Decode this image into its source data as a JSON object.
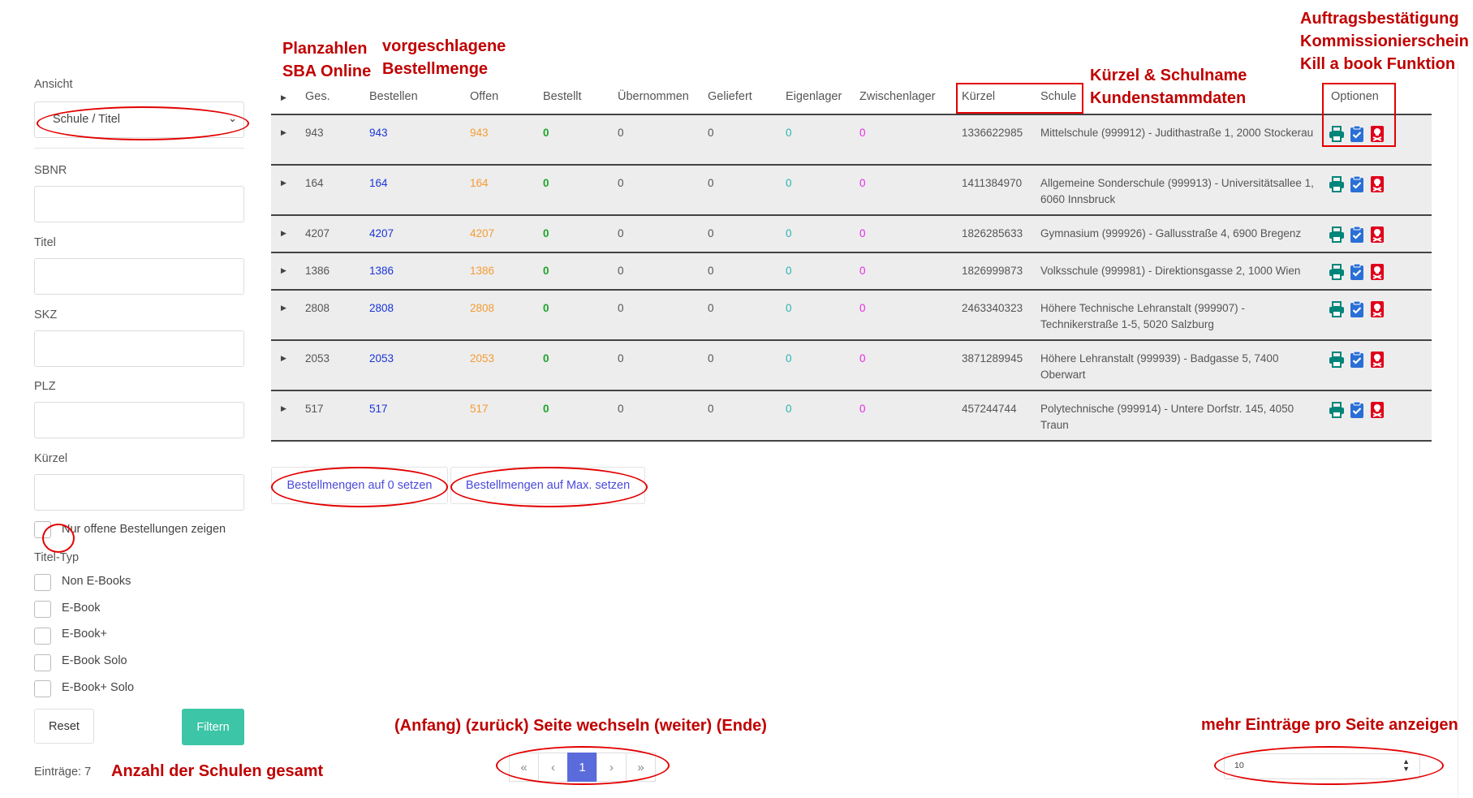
{
  "sidebar": {
    "view_label": "Ansicht",
    "view_value": "Schule / Titel",
    "sbnr_label": "SBNR",
    "title_label": "Titel",
    "skz_label": "SKZ",
    "plz_label": "PLZ",
    "kuerzel_label": "Kürzel",
    "open_only_label": "Nur offene Bestellungen zeigen",
    "title_type_label": "Titel-Typ",
    "title_types": [
      "Non E-Books",
      "E-Book",
      "E-Book+",
      "E-Book Solo",
      "E-Book+ Solo"
    ],
    "reset_label": "Reset",
    "filter_label": "Filtern",
    "entries_text": "Einträge: 7",
    "filter_color": "#3cc5a6"
  },
  "table": {
    "headers": {
      "ges": "Ges.",
      "bestellen": "Bestellen",
      "offen": "Offen",
      "bestellt": "Bestellt",
      "uebernommen": "Übernommen",
      "geliefert": "Geliefert",
      "eigenlager": "Eigenlager",
      "zwischenlager": "Zwischenlager",
      "kuerzel": "Kürzel",
      "schule": "Schule",
      "optionen": "Optionen"
    },
    "rows": [
      {
        "ges": "943",
        "bestellen": "943",
        "offen": "943",
        "bestellt": "0",
        "uebernommen": "0",
        "geliefert": "0",
        "eigenlager": "0",
        "zwischenlager": "0",
        "kuerzel": "1336622985",
        "schule": "Mittelschule (999912) - Judithastraße 1, 2000 Stockerau"
      },
      {
        "ges": "164",
        "bestellen": "164",
        "offen": "164",
        "bestellt": "0",
        "uebernommen": "0",
        "geliefert": "0",
        "eigenlager": "0",
        "zwischenlager": "0",
        "kuerzel": "1411384970",
        "schule": "Allgemeine Sonderschule (999913) - Universitätsallee 1, 6060 Innsbruck"
      },
      {
        "ges": "4207",
        "bestellen": "4207",
        "offen": "4207",
        "bestellt": "0",
        "uebernommen": "0",
        "geliefert": "0",
        "eigenlager": "0",
        "zwischenlager": "0",
        "kuerzel": "1826285633",
        "schule": "Gymnasium (999926) - Gallusstraße 4, 6900 Bregenz"
      },
      {
        "ges": "1386",
        "bestellen": "1386",
        "offen": "1386",
        "bestellt": "0",
        "uebernommen": "0",
        "geliefert": "0",
        "eigenlager": "0",
        "zwischenlager": "0",
        "kuerzel": "1826999873",
        "schule": "Volksschule (999981) - Direktionsgasse 2, 1000 Wien"
      },
      {
        "ges": "2808",
        "bestellen": "2808",
        "offen": "2808",
        "bestellt": "0",
        "uebernommen": "0",
        "geliefert": "0",
        "eigenlager": "0",
        "zwischenlager": "0",
        "kuerzel": "2463340323",
        "schule": "Höhere Technische Lehranstalt (999907) - Technikerstraße 1-5, 5020 Salzburg"
      },
      {
        "ges": "2053",
        "bestellen": "2053",
        "offen": "2053",
        "bestellt": "0",
        "uebernommen": "0",
        "geliefert": "0",
        "eigenlager": "0",
        "zwischenlager": "0",
        "kuerzel": "3871289945",
        "schule": "Höhere Lehranstalt (999939) - Badgasse 5, 7400 Oberwart"
      },
      {
        "ges": "517",
        "bestellen": "517",
        "offen": "517",
        "bestellt": "0",
        "uebernommen": "0",
        "geliefert": "0",
        "eigenlager": "0",
        "zwischenlager": "0",
        "kuerzel": "457244744",
        "schule": "Polytechnische (999914) - Untere Dorfstr. 145, 4050 Traun"
      }
    ],
    "option_icons": [
      "print-icon",
      "clipboard-check-icon",
      "skull-icon"
    ]
  },
  "bulk": {
    "zero_label": "Bestellmengen auf 0 setzen",
    "max_label": "Bestellmengen auf Max. setzen"
  },
  "pagination": {
    "first": "«",
    "prev": "‹",
    "current": "1",
    "next": "›",
    "last": "»"
  },
  "per_page": {
    "value": "10"
  },
  "annotations": {
    "planzahlen": "Planzahlen\nSBA Online",
    "vorgeschlagen": "vorgeschlagene\nBestellmenge",
    "kuerzel_schulname": "Kürzel & Schulname\nKundenstammdaten",
    "auftrag": "Auftragsbestätigung\nKommissionierschein\nKill a book Funktion",
    "pagination": "(Anfang) (zurück) Seite wechseln (weiter) (Ende)",
    "per_page": "mehr Einträge pro Seite anzeigen",
    "count": "Anzahl der Schulen gesamt"
  },
  "colors": {
    "annotation": "#c00000",
    "blue_value": "#1a35d6",
    "orange_value": "#f39c33",
    "green_value": "#1fa32b",
    "teal_value": "#2ab3b4",
    "pink_value": "#e62ae6",
    "icon_teal": "#00857a",
    "icon_blue": "#2a6fd6",
    "icon_red": "#e0001b",
    "pager_active": "#5a6bdb"
  }
}
